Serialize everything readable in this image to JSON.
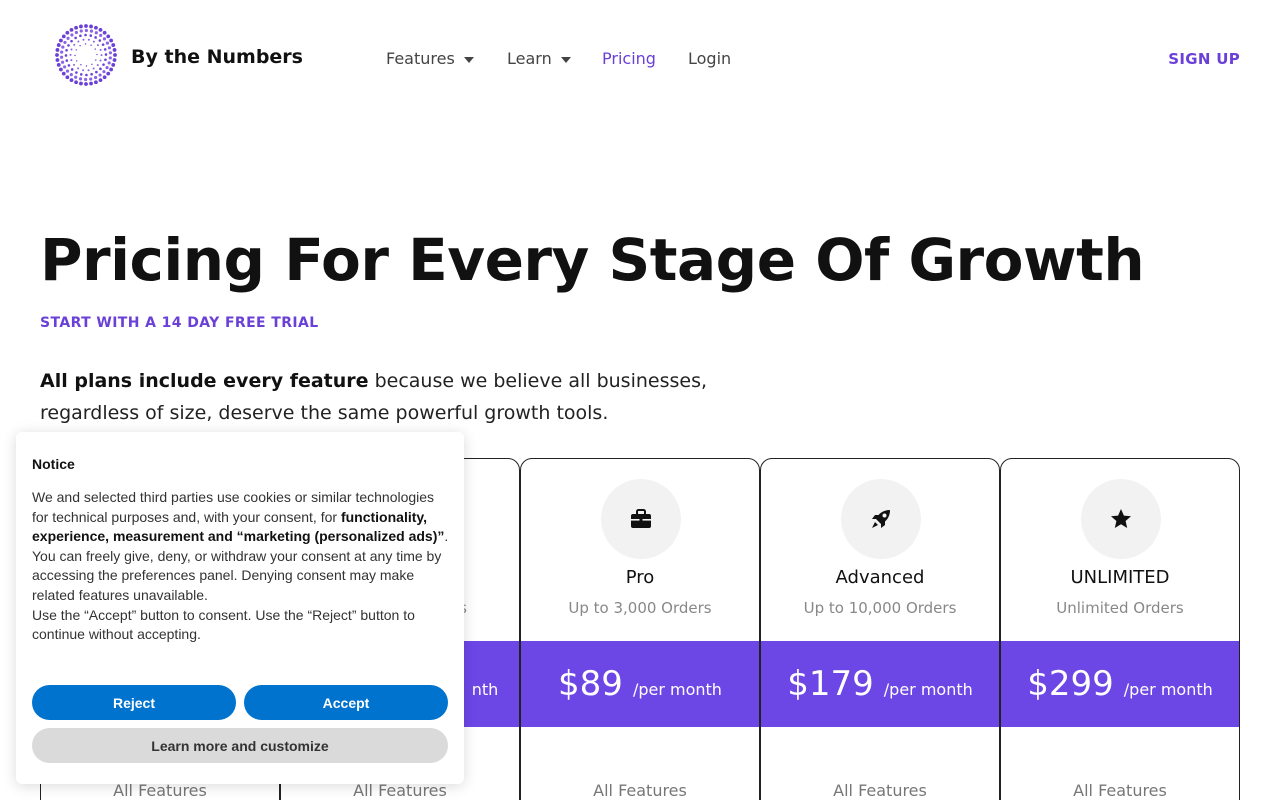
{
  "header": {
    "brand": "By the Numbers",
    "nav": {
      "features": "Features",
      "learn": "Learn",
      "pricing": "Pricing",
      "login": "Login"
    },
    "signup": "SIGN UP"
  },
  "hero": {
    "title": "Pricing For Every Stage Of Growth",
    "subtitle": "START WITH A 14 DAY FREE TRIAL",
    "description_bold": "All plans include every feature",
    "description_rest": " because we believe all businesses, regardless of size, deserve the same powerful growth tools."
  },
  "plans": [
    {
      "name": "Pro",
      "orders": "Up to 3,000 Orders",
      "price": "$89",
      "period": "/per month",
      "features": "All Features",
      "icon": "briefcase-icon"
    },
    {
      "name": "Advanced",
      "orders": "Up to 10,000 Orders",
      "price": "$179",
      "period": "/per month",
      "features": "All Features",
      "icon": "rocket-icon"
    },
    {
      "name": "UNLIMITED",
      "orders": "Unlimited Orders",
      "price": "$299",
      "period": "/per month",
      "features": "All Features",
      "icon": "star-icon"
    }
  ],
  "hidden_plans": [
    {
      "orders_fragment": "s",
      "period_fragment": "nth",
      "features": "All Features"
    },
    {
      "features": "All Features"
    }
  ],
  "notice": {
    "title": "Notice",
    "p1_start": "We and selected third parties use cookies or similar technologies for technical purposes and, with your consent, for ",
    "p1_bold": "functionality, experience, measurement and “marketing (personalized ads)”",
    "p1_end": ".",
    "p2": "You can freely give, deny, or withdraw your consent at any time by accessing the preferences panel. Denying consent may make related features unavailable.",
    "p3": "Use the “Accept” button to consent. Use the “Reject” button to continue without accepting.",
    "reject": "Reject",
    "accept": "Accept",
    "learn_more": "Learn more and customize"
  },
  "colors": {
    "accent": "#6a40d6",
    "price_band": "#6d46e6",
    "consent_button": "#0073ce"
  }
}
